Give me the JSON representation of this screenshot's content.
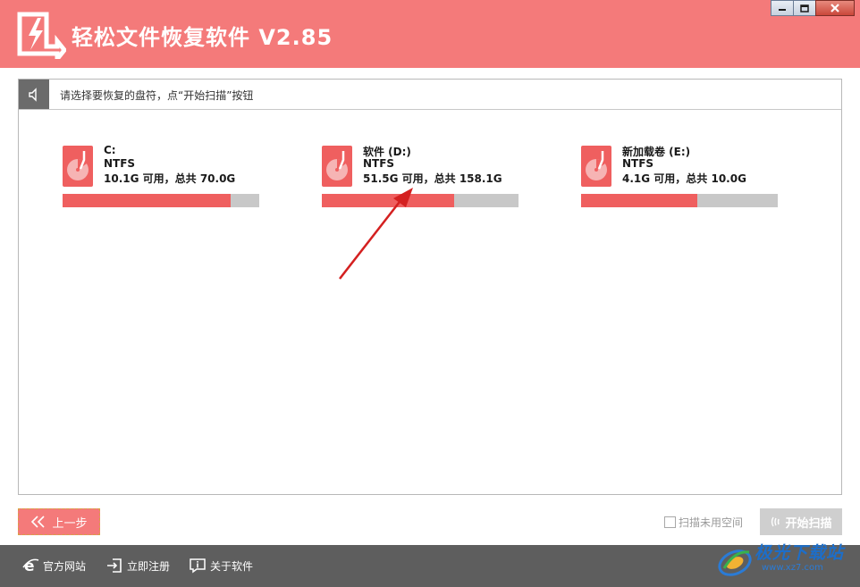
{
  "window": {
    "title": "轻松文件恢复软件 V2.85",
    "controls": [
      "minimize-icon",
      "maximize-icon",
      "close-icon"
    ]
  },
  "colors": {
    "accent": "#f47a7a",
    "bar_used": "#ef5f5f",
    "bar_free": "#c8c8c8",
    "footer": "#5e5e5e"
  },
  "instruction": "请选择要恢复的盘符，点“开始扫描”按钮",
  "drives": [
    {
      "name": "C:",
      "fs": "NTFS",
      "space": "10.1G 可用，总共 70.0G",
      "used_fraction": 0.856
    },
    {
      "name": "软件 (D:)",
      "fs": "NTFS",
      "space": "51.5G 可用，总共 158.1G",
      "used_fraction": 0.674
    },
    {
      "name": "新加载卷 (E:)",
      "fs": "NTFS",
      "space": "4.1G 可用，总共 10.0G",
      "used_fraction": 0.59
    }
  ],
  "actions": {
    "back_label": "上一步",
    "scan_unused_label": "扫描未用空间",
    "scan_unused_checked": false,
    "start_scan_label": "开始扫描"
  },
  "footer": {
    "website_label": "官方网站",
    "register_label": "立即注册",
    "about_label": "关于软件"
  },
  "watermark": {
    "text": "极光下载站",
    "url": "www.xz7.com"
  }
}
